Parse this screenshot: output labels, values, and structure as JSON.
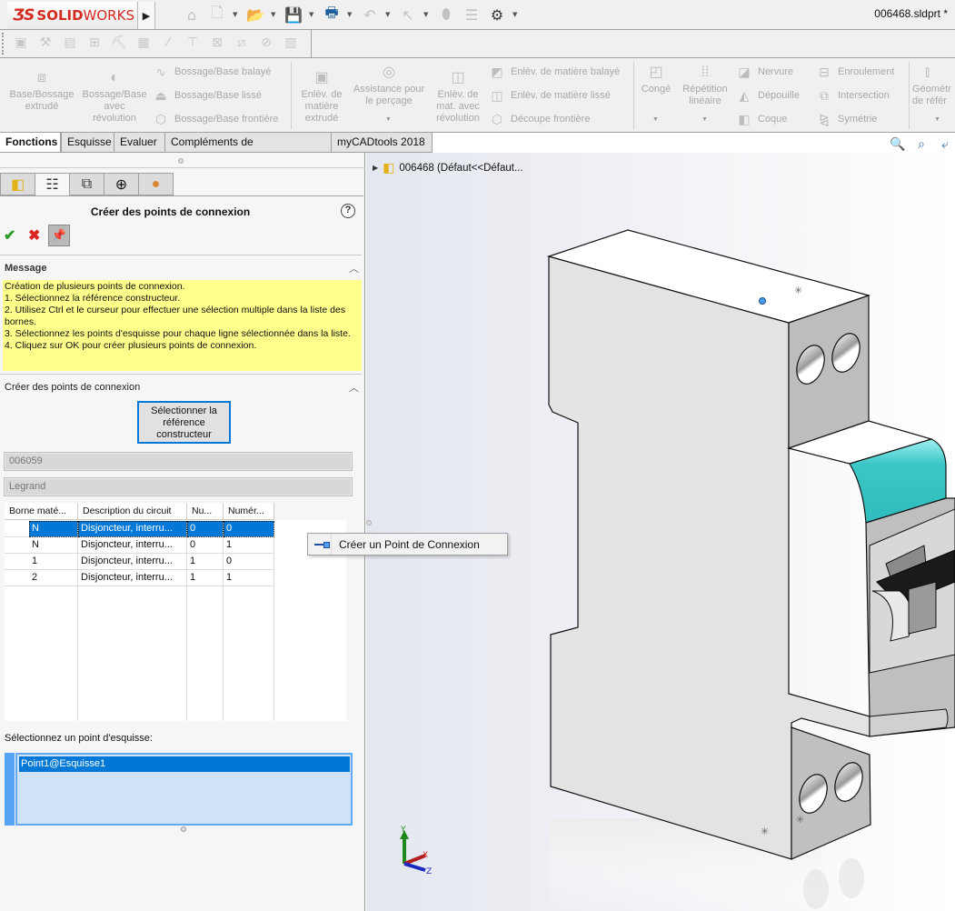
{
  "app": {
    "brand": "SOLIDWORKS",
    "brand_logo": "ds-logo",
    "document_title": "006468.sldprt *"
  },
  "quick_access": [
    {
      "icon": "home-icon"
    },
    {
      "icon": "new-document-icon"
    },
    {
      "icon": "open-folder-icon"
    },
    {
      "icon": "save-icon"
    },
    {
      "icon": "print-icon"
    },
    {
      "icon": "undo-icon"
    },
    {
      "icon": "select-cursor-icon"
    },
    {
      "icon": "rebuild-icon"
    },
    {
      "icon": "file-properties-icon"
    },
    {
      "icon": "gear-icon"
    }
  ],
  "ribbon": {
    "large_buttons": [
      {
        "id": "base-bossage-extrude",
        "label": "Base/Bossage\nextrudé"
      },
      {
        "id": "bossage-revolution",
        "label": "Bossage/Base\navec\nrévolution"
      },
      {
        "id": "enlev-extrude",
        "label": "Enlèv. de\nmatière\nextrudé"
      },
      {
        "id": "assistance-percage",
        "label": "Assistance pour\nle perçage"
      },
      {
        "id": "enlev-revolution",
        "label": "Enlèv. de\nmat. avec\nrévolution"
      },
      {
        "id": "conge",
        "label": "Congé"
      },
      {
        "id": "repetition-lineaire",
        "label": "Répétition\nlinéaire"
      },
      {
        "id": "geometrie-reference",
        "label": "Géométr\nde référ"
      }
    ],
    "small_buttons": [
      {
        "id": "bossage-balaye",
        "label": "Bossage/Base balayé"
      },
      {
        "id": "bossage-lisse",
        "label": "Bossage/Base lissé"
      },
      {
        "id": "bossage-frontiere",
        "label": "Bossage/Base frontière"
      },
      {
        "id": "enlev-balaye",
        "label": "Enlèv. de matière balayé"
      },
      {
        "id": "enlev-lisse",
        "label": "Enlèv. de matière lissé"
      },
      {
        "id": "decoupe-frontiere",
        "label": "Découpe frontière"
      },
      {
        "id": "nervure",
        "label": "Nervure"
      },
      {
        "id": "depouille",
        "label": "Dépouille"
      },
      {
        "id": "coque",
        "label": "Coque"
      },
      {
        "id": "enroulement",
        "label": "Enroulement"
      },
      {
        "id": "intersection",
        "label": "Intersection"
      },
      {
        "id": "symetrie",
        "label": "Symétrie"
      }
    ]
  },
  "command_tabs": [
    {
      "label": "Fonctions",
      "active": true
    },
    {
      "label": "Esquisse",
      "active": false
    },
    {
      "label": "Evaluer",
      "active": false
    },
    {
      "label": "Compléments de SOLIDWORKS",
      "active": false
    },
    {
      "label": "myCADtools 2018",
      "active": false
    }
  ],
  "panel_tabs": [
    {
      "icon": "feature-manager-icon"
    },
    {
      "icon": "property-manager-icon",
      "active": true
    },
    {
      "icon": "configuration-manager-icon"
    },
    {
      "icon": "dimxpert-icon"
    },
    {
      "icon": "display-manager-icon"
    }
  ],
  "property_manager": {
    "title": "Créer des points de connexion",
    "message_header": "Message",
    "message_lines": [
      "Création de plusieurs points de connexion.",
      "1. Sélectionnez la référence constructeur.",
      "2. Utilisez Ctrl et le curseur pour effectuer une sélection multiple dans la liste des bornes.",
      "3. Sélectionnez les points d'esquisse pour chaque ligne sélectionnée dans la liste.",
      "4. Cliquez sur OK pour créer plusieurs points de connexion."
    ],
    "section_header": "Créer des points de connexion",
    "select_ref_button": "Sélectionner la référence constructeur",
    "reference_value": "006059",
    "manufacturer_value": "Legrand",
    "table": {
      "columns": [
        "Borne maté...",
        "Description du circuit",
        "Nu...",
        "Numér..."
      ],
      "rows": [
        {
          "borne": "N",
          "description": "Disjoncteur, interru...",
          "nu": "0",
          "numero": "0",
          "selected": true
        },
        {
          "borne": "N",
          "description": "Disjoncteur, interru...",
          "nu": "0",
          "numero": "1",
          "selected": false
        },
        {
          "borne": "1",
          "description": "Disjoncteur, interru...",
          "nu": "1",
          "numero": "0",
          "selected": false
        },
        {
          "borne": "2",
          "description": "Disjoncteur, interru...",
          "nu": "1",
          "numero": "1",
          "selected": false
        }
      ]
    },
    "sketch_point_label": "Sélectionnez un point d'esquisse:",
    "sketch_point_selection": "Point1@Esquisse1"
  },
  "context_menu": {
    "item_label": "Créer un Point de Connexion",
    "item_icon": "connection-point-icon"
  },
  "feature_tree": {
    "node_label": "006468  (Défaut<<Défaut..."
  },
  "triad": {
    "x": "X",
    "y": "Y",
    "z": "Z"
  },
  "colors": {
    "accent_blue": "#0078d7",
    "message_yellow": "#ffff8c",
    "brand_red": "#d42a20",
    "part_teal": "#3cc6c6"
  }
}
